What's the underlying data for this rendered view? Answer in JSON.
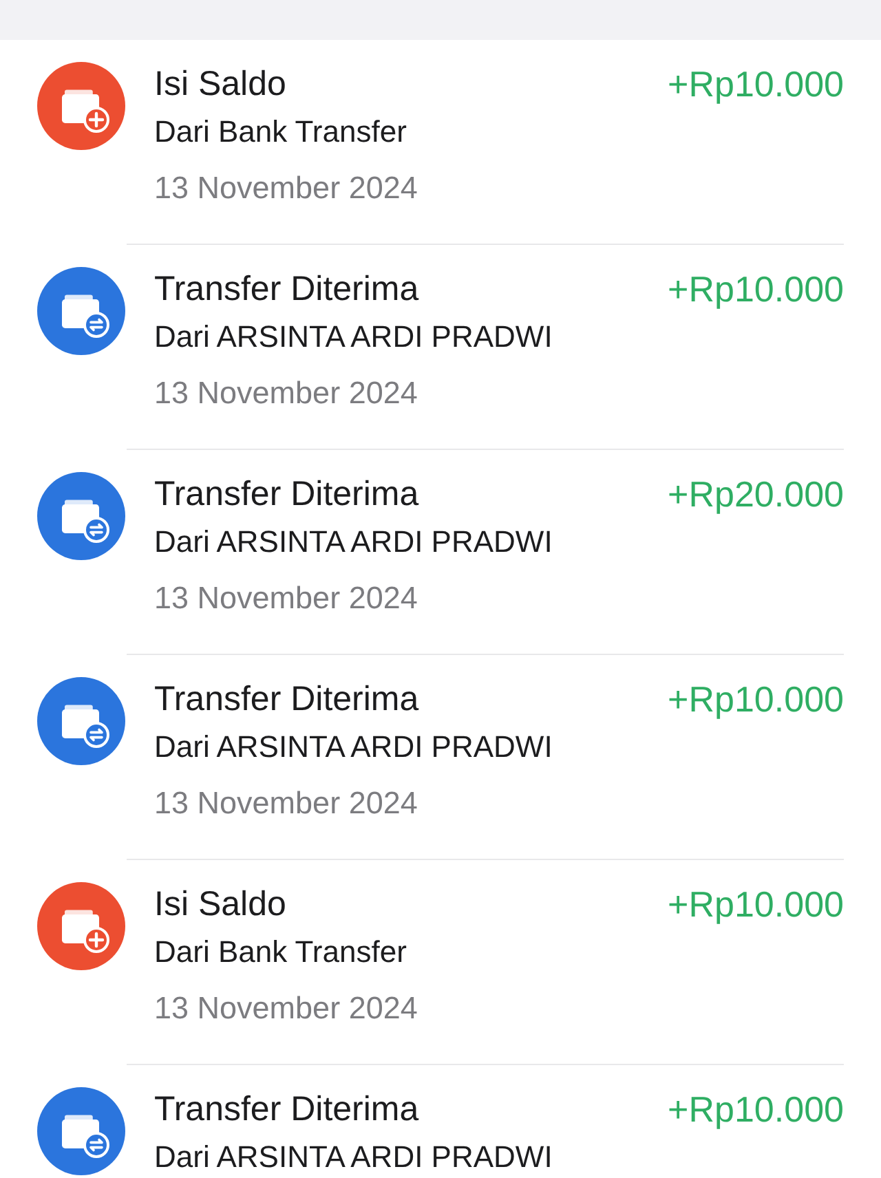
{
  "transactions": [
    {
      "kind": "topup",
      "title": "Isi Saldo",
      "amount": "+Rp10.000",
      "subtitle": "Dari Bank Transfer",
      "date": "13 November 2024"
    },
    {
      "kind": "transfer",
      "title": "Transfer Diterima",
      "amount": "+Rp10.000",
      "subtitle": "Dari ARSINTA ARDI PRADWI",
      "date": "13 November 2024"
    },
    {
      "kind": "transfer",
      "title": "Transfer Diterima",
      "amount": "+Rp20.000",
      "subtitle": "Dari ARSINTA ARDI PRADWI",
      "date": "13 November 2024"
    },
    {
      "kind": "transfer",
      "title": "Transfer Diterima",
      "amount": "+Rp10.000",
      "subtitle": "Dari ARSINTA ARDI PRADWI",
      "date": "13 November 2024"
    },
    {
      "kind": "topup",
      "title": "Isi Saldo",
      "amount": "+Rp10.000",
      "subtitle": "Dari Bank Transfer",
      "date": "13 November 2024"
    },
    {
      "kind": "transfer",
      "title": "Transfer Diterima",
      "amount": "+Rp10.000",
      "subtitle": "Dari ARSINTA ARDI PRADWI"
    }
  ]
}
